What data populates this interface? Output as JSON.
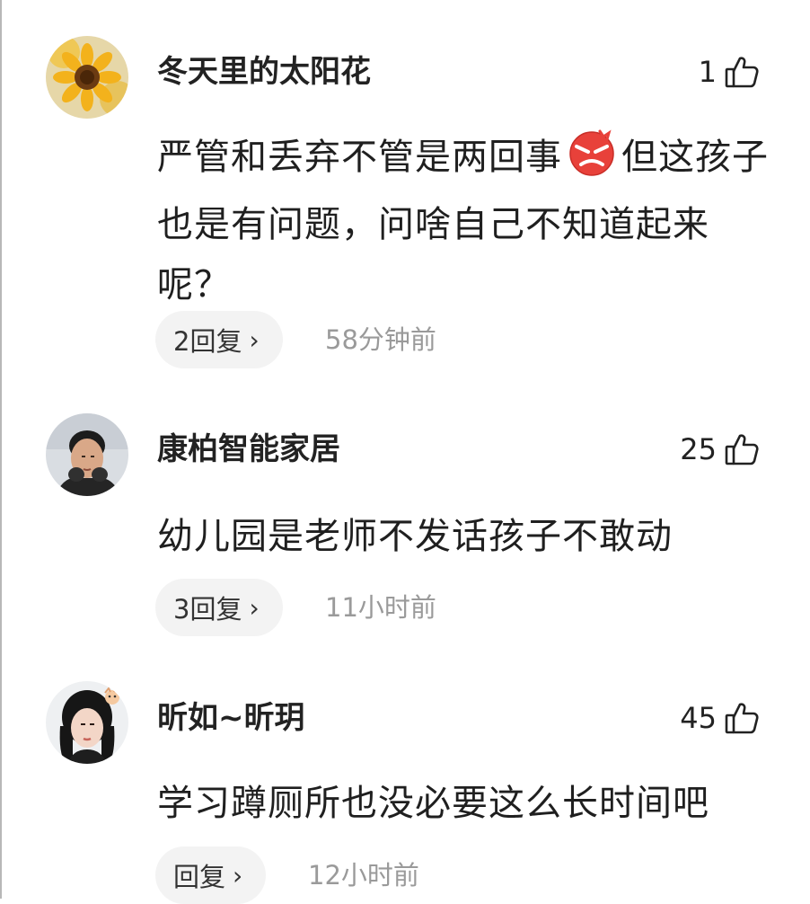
{
  "comments": [
    {
      "username": "冬天里的太阳花",
      "likes": "1",
      "text_before_emoji": "严管和丢弃不管是两回事",
      "emoji": "angry-face-icon",
      "text_after_emoji": "但这孩子也是有问题，问啥自己不知道起来呢？",
      "reply_label": "2回复",
      "time": "58分钟前"
    },
    {
      "username": "康柏智能家居",
      "likes": "25",
      "text": "幼儿园是老师不发话孩子不敢动",
      "reply_label": "3回复",
      "time": "11小时前"
    },
    {
      "username": "昕如~昕玥",
      "likes": "45",
      "text": "学习蹲厕所也没必要这么长时间吧",
      "reply_label": "回复",
      "time": "12小时前"
    }
  ],
  "icons": {
    "like": "thumbs-up-outline-icon",
    "reply_chevron": "chevron-right-icon"
  },
  "colors": {
    "text_primary": "#222222",
    "text_secondary": "#9a9a9a",
    "pill_bg": "#f3f3f3",
    "angry_emoji": "#e8413a"
  }
}
